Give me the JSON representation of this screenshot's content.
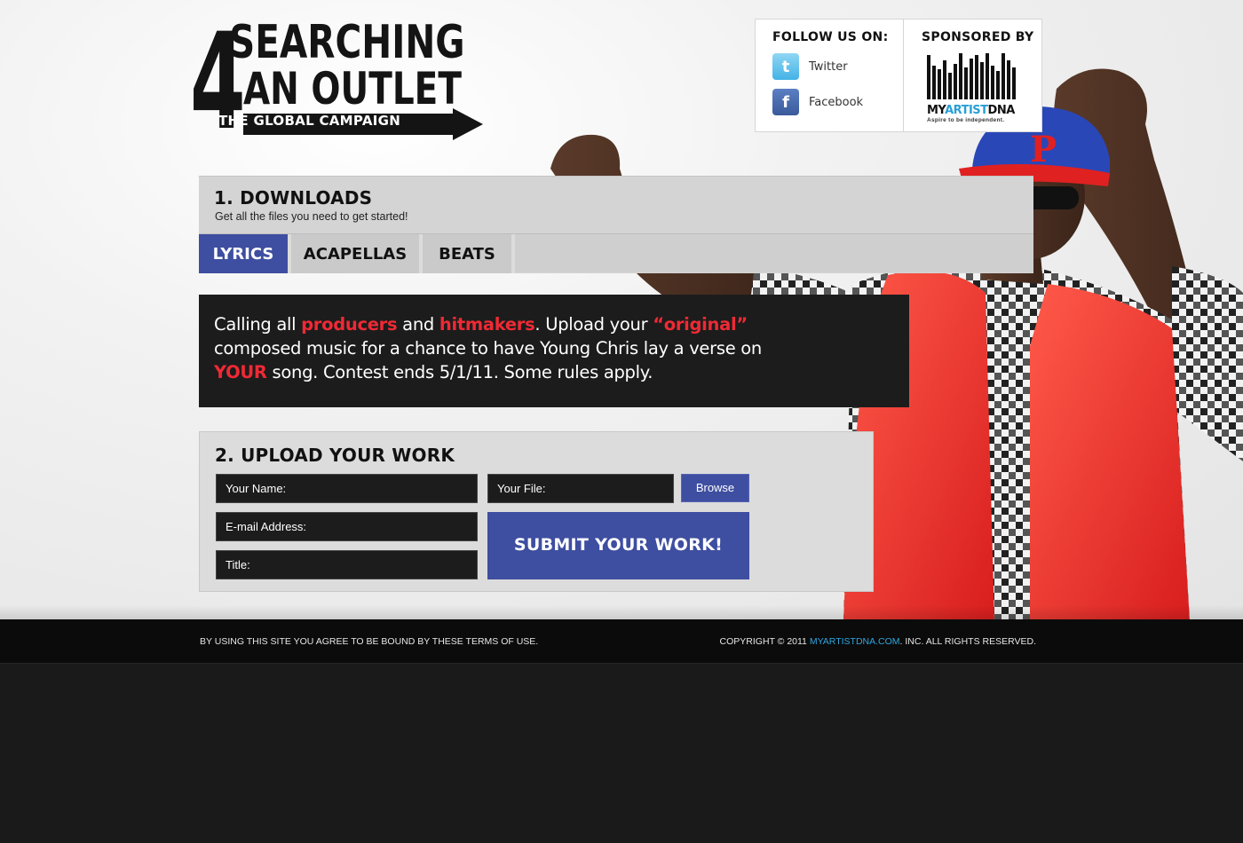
{
  "logo": {
    "number": "4",
    "line1": "SEARCHING",
    "line2": "AN OUTLET",
    "line3": "THE GLOBAL CAMPAIGN"
  },
  "follow": {
    "heading": "FOLLOW US ON:",
    "twitter_label": "Twitter",
    "facebook_label": "Facebook"
  },
  "sponsor": {
    "heading": "SPONSORED BY",
    "name_a": "MY",
    "name_b": "ARTIST",
    "name_c": "DNA",
    "tagline": "Aspire to be independent."
  },
  "downloads": {
    "title": "1. DOWNLOADS",
    "subtitle": "Get all the files you need to get started!",
    "tabs": [
      {
        "label": "LYRICS",
        "active": true
      },
      {
        "label": "ACAPELLAS",
        "active": false
      },
      {
        "label": "BEATS",
        "active": false
      }
    ]
  },
  "promo": {
    "t1": "Calling all ",
    "h1": "producers",
    "t2": " and ",
    "h2": "hitmakers",
    "t3": ". Upload your ",
    "h3": "“original”",
    "t4": " composed music for a chance to have Young Chris lay a verse on ",
    "h4": "YOUR",
    "t5": " song. Contest ends 5/1/11. Some rules apply."
  },
  "upload": {
    "title": "2. UPLOAD YOUR WORK",
    "name_placeholder": "Your Name:",
    "email_placeholder": "E-mail Address:",
    "title_placeholder": "Title:",
    "file_placeholder": "Your File:",
    "browse_label": "Browse",
    "submit_label": "SUBMIT YOUR WORK!"
  },
  "footer": {
    "left": "BY USING THIS SITE YOU AGREE TO BE BOUND BY THESE TERMS OF USE.",
    "copyright_prefix": "COPYRIGHT © 2011 ",
    "copyright_link": "MYARTISTDNA.COM",
    "copyright_suffix": ". INC. ALL RIGHTS RESERVED."
  },
  "colors": {
    "accent_blue": "#3e4ea0",
    "highlight_red": "#ee2a35",
    "link_blue": "#2fa6e0"
  }
}
